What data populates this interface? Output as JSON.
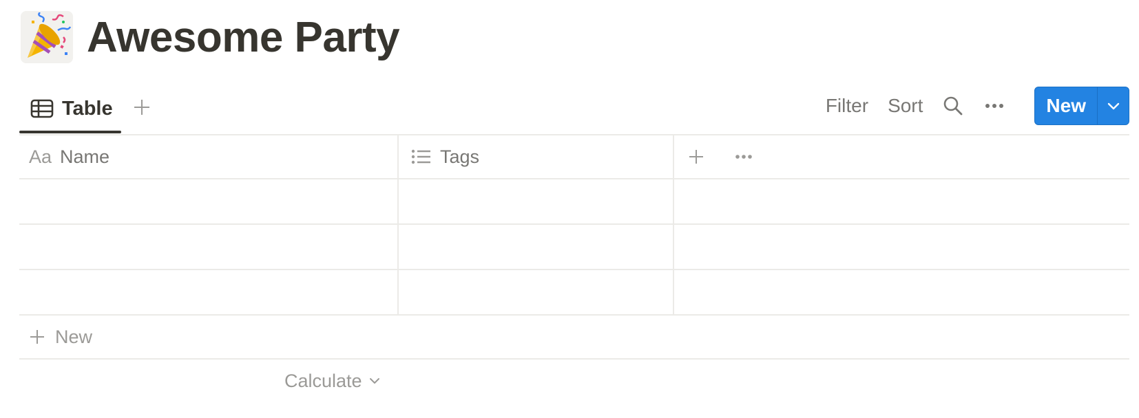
{
  "page": {
    "icon": "party-popper-icon",
    "title": "Awesome Party"
  },
  "views": {
    "tabs": [
      {
        "label": "Table",
        "icon": "table-icon",
        "active": true
      }
    ],
    "add_icon": "plus-icon"
  },
  "toolbar": {
    "filter_label": "Filter",
    "sort_label": "Sort",
    "search_icon": "search-icon",
    "more_icon": "more-horizontal-icon",
    "new_label": "New",
    "new_dropdown_icon": "chevron-down-icon",
    "accent_color": "#2383e2"
  },
  "table": {
    "columns": [
      {
        "label": "Name",
        "icon": "text-property-icon",
        "icon_text": "Aa"
      },
      {
        "label": "Tags",
        "icon": "multi-select-icon"
      }
    ],
    "add_column_icon": "plus-icon",
    "column_more_icon": "more-horizontal-icon",
    "rows": [
      {
        "name": "",
        "tags": ""
      },
      {
        "name": "",
        "tags": ""
      },
      {
        "name": "",
        "tags": ""
      }
    ],
    "new_row_label": "New",
    "calculate_label": "Calculate"
  }
}
